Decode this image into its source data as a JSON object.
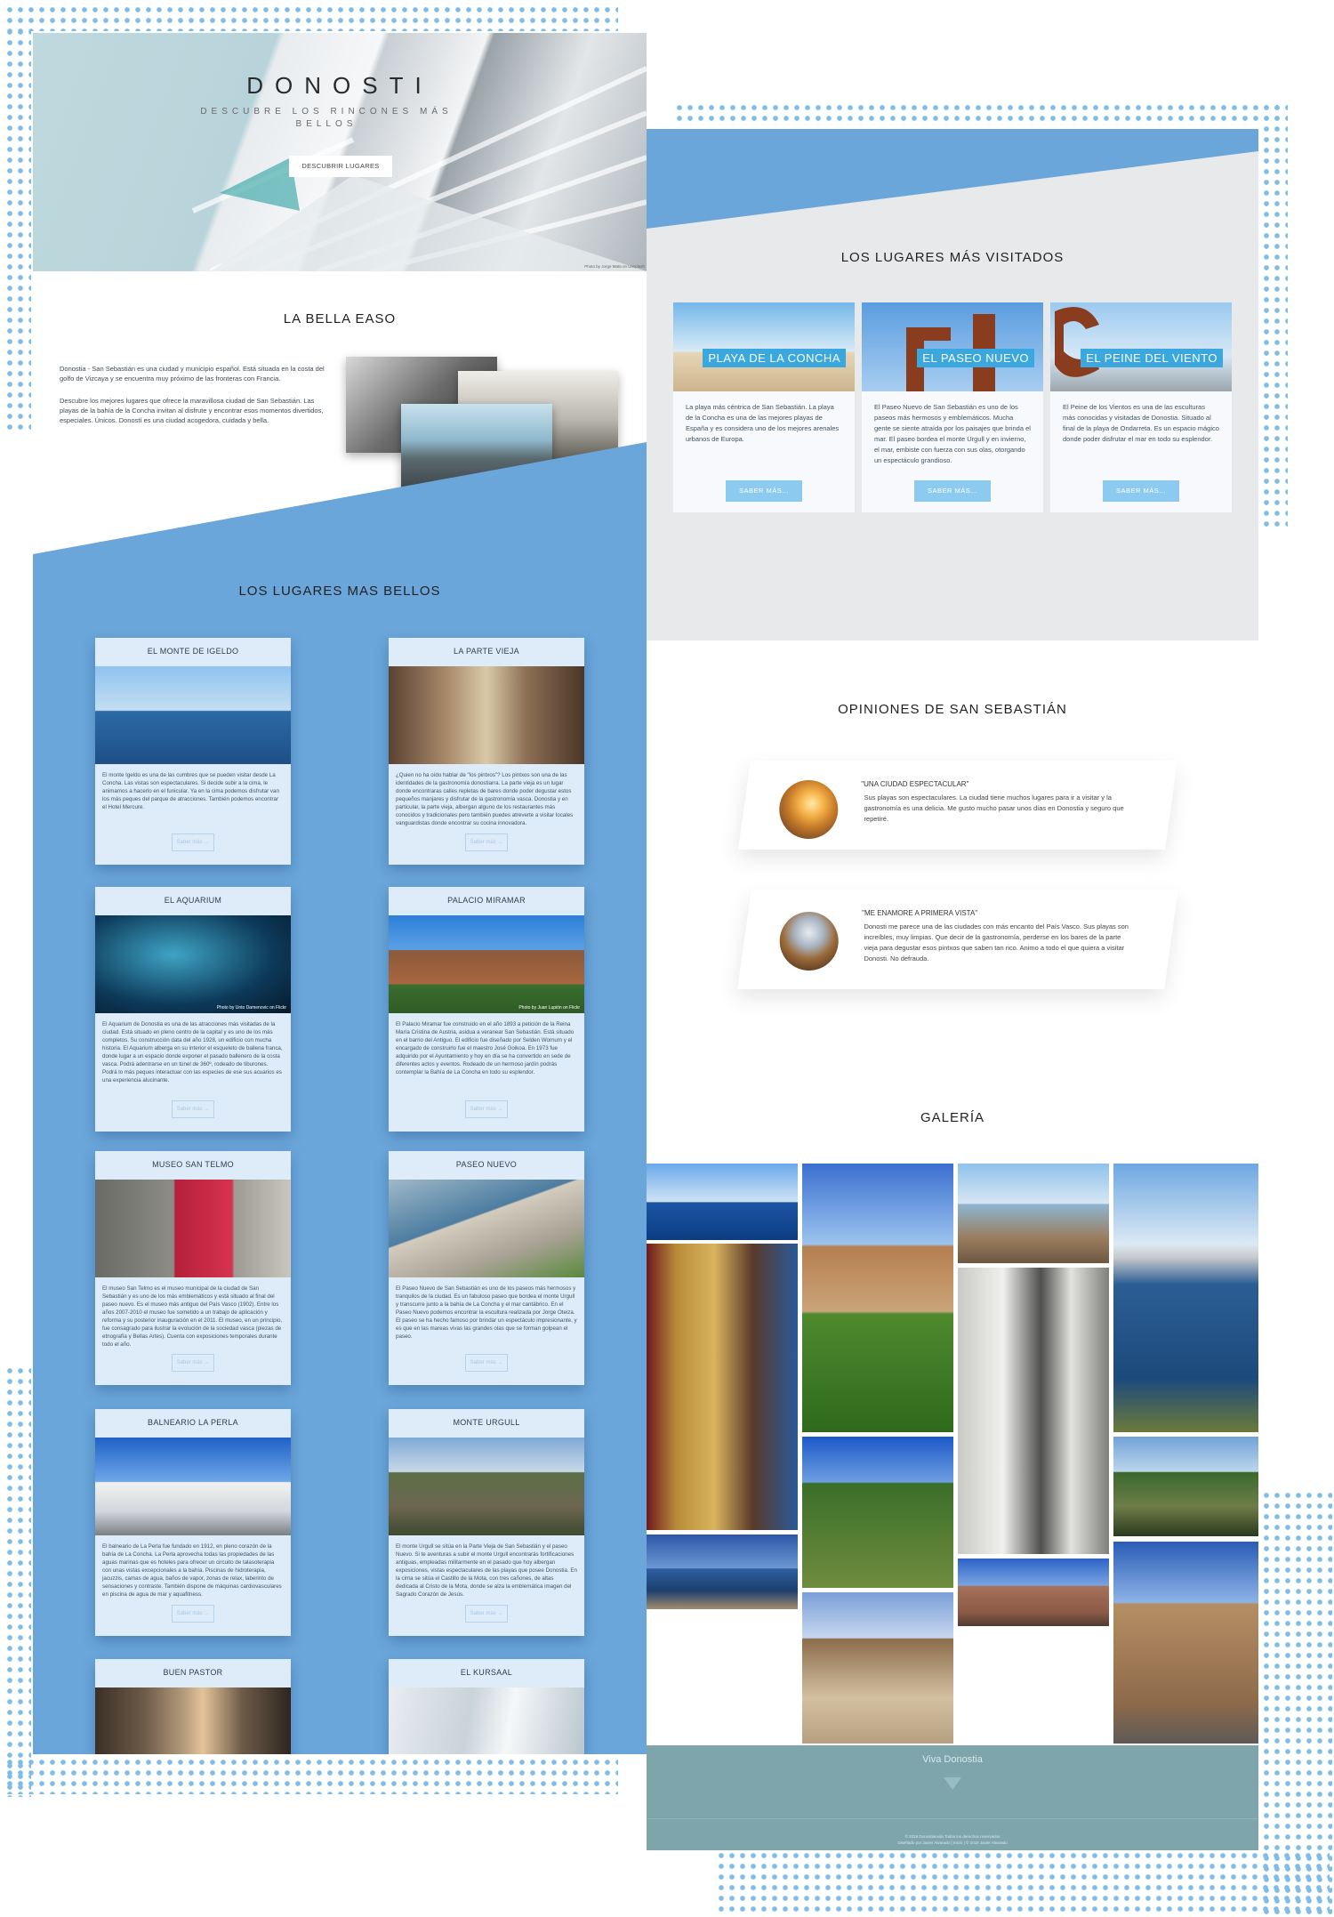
{
  "hero": {
    "title": "DONOSTI",
    "subtitle": "DESCUBRE LOS RINCONES MÁS BELLOS",
    "button": "DESCUBRIR LUGARES",
    "credit": "Photo by Jorge Mata on Unsplash"
  },
  "bella": {
    "title": "LA BELLA EASO",
    "p1": "Donostia - San Sebastián es una ciudad y municipio español. Está situada en la costa del golfo de Vizcaya y se encuentra muy próximo de las fronteras con Francia.",
    "p2": "Descubre los mejores lugares que ofrece la maravillosa ciudad de San Sebastián. Las playas de la bahía de la Concha invitan al disfrute y encontrar esos momentos divertidos, especiales. Únicos. Doností es una ciudad acogedora, cuidada y bella."
  },
  "bellos": {
    "title": "LOS LUGARES MAS BELLOS",
    "more": "Saber más →",
    "cards": [
      {
        "title": "EL MONTE DE IGELDO",
        "text": "El monte Igeldo es una de las cumbres que se pueden visitar desde La Concha. Las vistas son espectaculares. Si decide subir a la cima, le animamos a hacerlo en el funicular. Ya en la cima podemos disfrutar van los más peques del parque de atracciones. También podemos encontrar el Hotel Mercure."
      },
      {
        "title": "LA PARTE VIEJA",
        "text": "¿Quien no ha oído hablar de \"los pintxos\"? Los pintxos son una de las identidades de la gastronomía donostiarra. La parte vieja es un lugar donde encontraras calles repletas de bares donde poder degustar estos pequeños manjares y disfrutar de la gastronomía vasca. Donostia y en particular, la parte vieja, albergan alguno de los restaurantes más conocidos y tradicionales pero también puedes atreverte a visitar locales vanguardistas donde encontrar su cocina innovadora."
      },
      {
        "title": "EL AQUARIUM",
        "credit": "Photo by Unto Damenovic on Flickr",
        "text": "El Aquarium de Donostia es una de las atracciones más visitadas de la ciudad. Está situado en pleno centro de la capital y es uno de los más completos. Su construcción data del año 1928, un edificio con mucha historia. El Aquarium alberga en su interior el esqueleto de ballena franca, donde lugar a un espacio donde exponer el pasado ballenero de la costa vasca. Podrá adentrarse en un túnel de 360º, rodeado de tiburones. Podrá lo más peques interactuar con las especies de ese sus acuarios es una experiencia alucinante."
      },
      {
        "title": "PALACIO MIRAMAR",
        "credit": "Photo by Juan Lupión on Flickr",
        "text": "El Palacio Miramar fue construido en el año 1893 a petición de la Reina María Cristina de Austria, asidua a veranear San Sebastián. Está situado en el barrio del Antiguo. El edificio fue diseñado por Selden Wornum y el encargado de construirlo fue el maestro José Goikoa. En 1973 fue adquirido por el Ayuntamiento y hoy en día se ha convertido en sede de diferentes actos y eventos. Rodeado de un hermoso jardín podrás contemplar la Bahía de La Concha en todo su esplendor."
      },
      {
        "title": "MUSEO SAN TELMO",
        "text": "El museo San Telmo es el museo municipal de la ciudad de San Sebastián y es uno de los más emblemáticos y está situado al final del paseo nuevo. Es el museo más antiguo del País Vasco (1902). Entre los años 2007-2010 el museo fue sometido a un trabajo de aplicación y reforma y su posterior inauguración en el 2011. El museo, en un principio, fue consagrado para ilustrar la evolución de la sociedad vasca (piezas de etnografía y Bellas Artes). Cuenta con exposiciones temporales durante todo el año."
      },
      {
        "title": "PASEO NUEVO",
        "text": "El Paseo Nuevo de San Sebastián es uno de los paseos más hermosos y tranquilos de la ciudad. Es un fabuloso paseo que bordea el monte Urgull y transcurre junto a la bahía de La Concha y el mar cantábrico. En el Paseo Nuevo podemos encontrar la escultura realizada por Jorge Oteiza. El paseo se ha hecho famoso por brindar un espectáculo impresionante, y es que en las mareas vivas las grandes olas que se forman golpean el paseo."
      },
      {
        "title": "BALNEARIO LA PERLA",
        "text": "El balneario de La Perla fue fundado en 1912, en pleno corazón de la bahía de La Concha. La Perla aprovecha todas las propiedades de las aguas marinas que es hoteles para ofrecer un circuito de talasoterapia con unas vistas excepcionales a la bahía. Piscinas de hidroterapia, jacuzzis, camas de agua, baños de vapor, zonas de relax, laberinto de sensaciones y contraste. También dispone de máquinas cardiovasculares en piscina de agua de mar y aquafitness."
      },
      {
        "title": "MONTE URGULL",
        "text": "El monte Urgull se sitúa en la Parte Vieja de San Sebastián y el paseo Nuevo. Si te aventuras a subir el monte Urgull encontrarás fortificaciones antiguas, empleadas militarmente en el pasado que hoy albergan exposiciones, vistas espectaculares de las playas que posee Donostia. En la cima se sitúa el Castillo de la Mota, con tres cañones, de altas dedicada al Cristo de la Mota, donde se alza la emblemática imagen del Sagrado Corazón de Jesús."
      },
      {
        "title": "BUEN PASTOR"
      },
      {
        "title": "EL KURSAAL"
      }
    ]
  },
  "visitados": {
    "title": "LOS LUGARES MÁS VISITADOS",
    "button": "SABER MÁS...",
    "cards": [
      {
        "badge": "PLAYA DE LA CONCHA",
        "text": "La playa más céntrica de San Sebastián. La playa de la Concha es una de las mejores playas de España y es considera uno de los mejores arenales urbanos de Europa."
      },
      {
        "badge": "EL PASEO NUEVO",
        "text": "El Paseo Nuevo de San Sebastián es uno de los paseos más hermosos y emblemáticos. Mucha gente se siente atraída por los paisajes que brinda el mar. El paseo bordea el monte Urgull y en invierno, el mar, embiste con fuerza con sus olas, otorgando un espectáculo grandioso."
      },
      {
        "badge": "EL PEINE DEL VIENTO",
        "text": "El Peine de los Vientos es una de las esculturas más conocidas y visitadas de Donostia. Situado al final de la playa de Ondarreta. Es un espacio mágico donde poder disfrutar el mar en todo su esplendor."
      }
    ]
  },
  "opiniones": {
    "title": "OPINIONES DE SAN SEBASTIÁN",
    "items": [
      {
        "quote": "\"UNA CIUDAD ESPECTACULAR\"",
        "text": "Sus playas son espectaculares. La ciudad tiene muchos lugares para ir a visitar y la gastronomía es una delicia. Me gusto mucho pasar unos días en Donostia y seguro que repetiré."
      },
      {
        "quote": "\"ME ENAMORE A PRIMERA VISTA\"",
        "text": "Donosti me parece una de las ciudades con más encanto del País Vasco. Sus playas son increíbles, muy limpias. Que decir de la gastronomía, perderse en los bares de la parte vieja para degustar esos pintxos que saben tan rico. Animo a todo el que quiera a visitar Donosti. No defrauda."
      }
    ]
  },
  "galeria": {
    "title": "GALERÍA"
  },
  "footer": {
    "title": "Viva Donostia",
    "line1": "© 2019 Donostiamola Todos los derechos reservados",
    "line2": "Diseñado por Javier Alvarado | Inicio | © 2019 Javier Alvarado"
  },
  "colors": {
    "accent": "#6aa6da",
    "badge": "#3aa8de",
    "footer": "#7ea5ac",
    "card": "#deebf8"
  }
}
